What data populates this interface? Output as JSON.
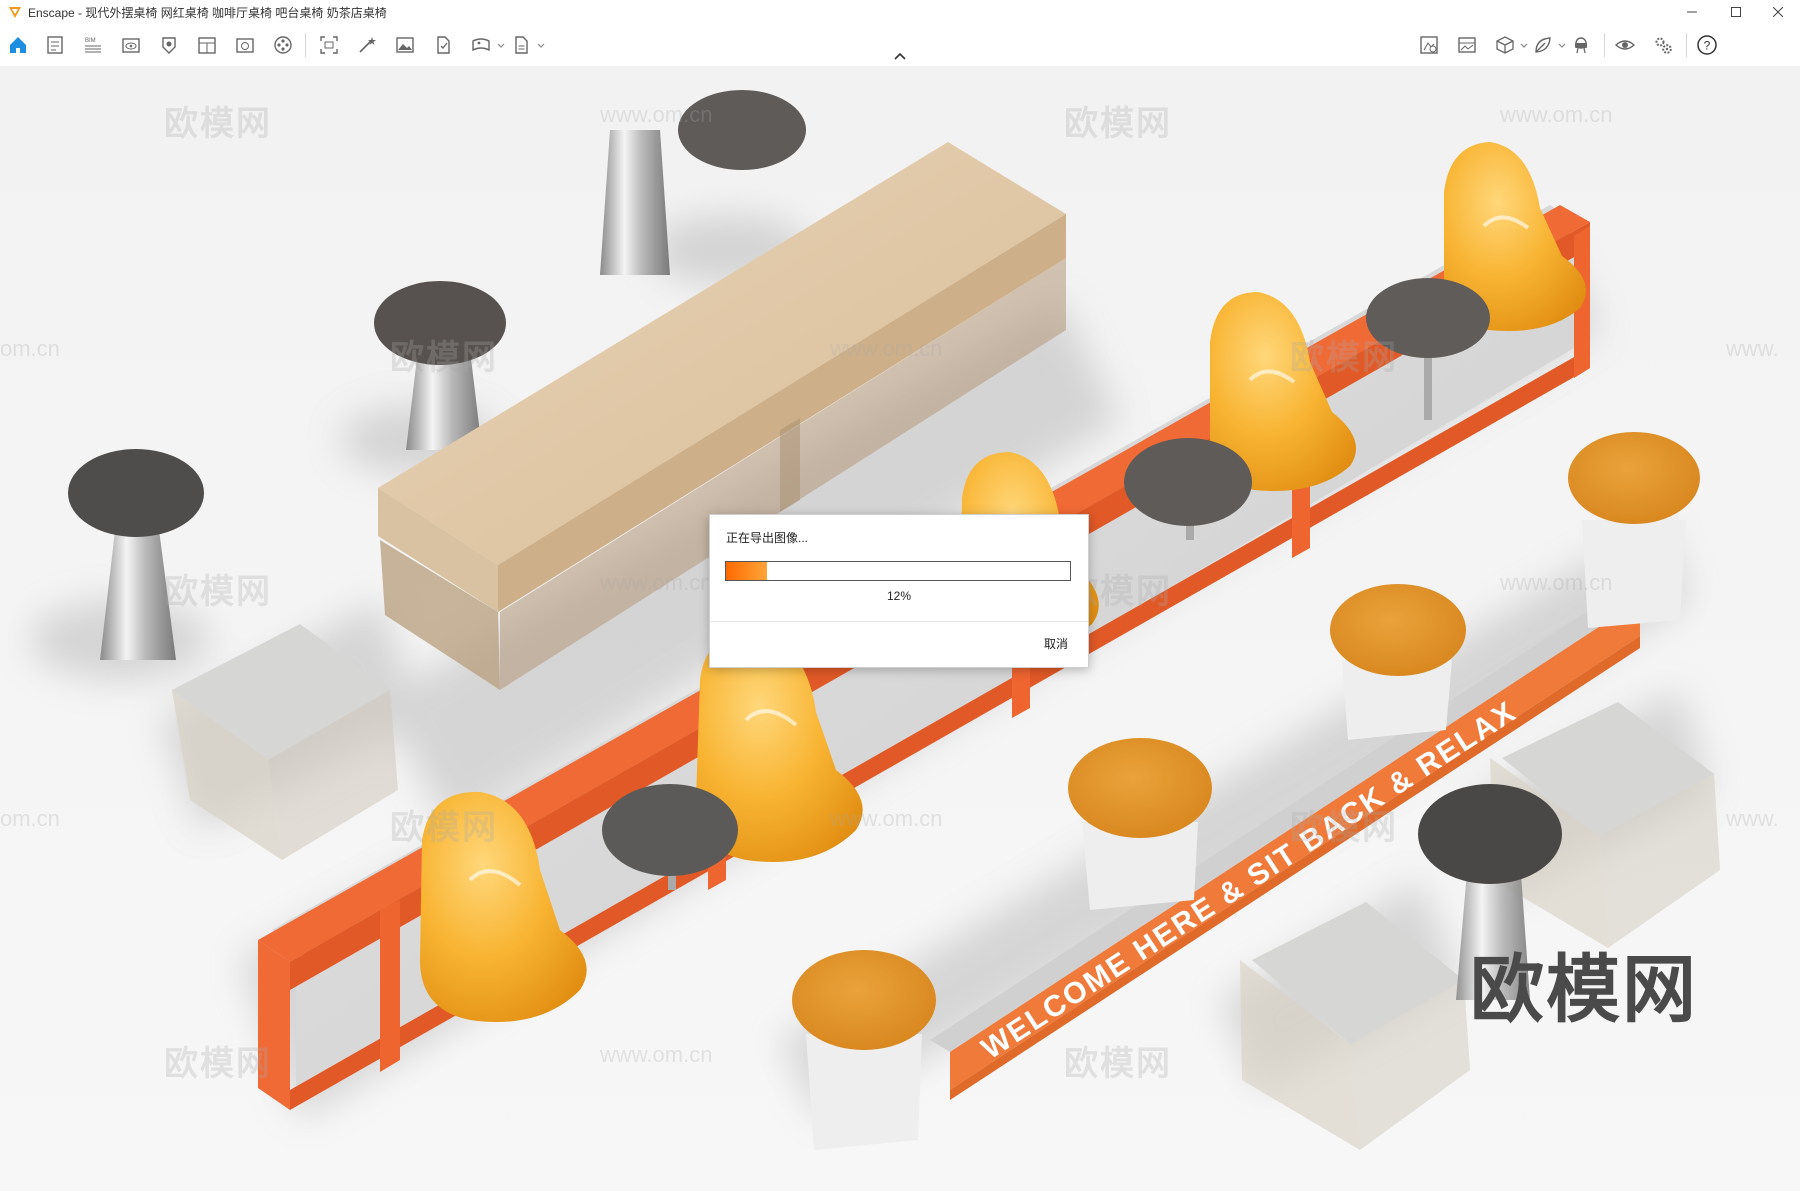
{
  "window": {
    "app_name": "Enscape",
    "title": "Enscape - 现代外摆桌椅 网红桌椅 咖啡厅桌椅 吧台桌椅 奶茶店桌椅",
    "controls": [
      "minimize-icon",
      "maximize-icon",
      "close-icon"
    ]
  },
  "toolbar": {
    "left_icons": [
      "home-icon",
      "render-settings-icon",
      "bim-icon",
      "view-icon",
      "asset-library-icon",
      "material-editor-icon",
      "capture-icon",
      "video-editor-icon",
      "screenshot-icon",
      "batch-render-icon",
      "image-icon",
      "export-icon",
      "panorama-icon",
      "exe-export-icon"
    ],
    "bim_label": "BIM",
    "right_icons": [
      "sync-views-icon",
      "image-compare-icon",
      "box-icon",
      "leaf-icon",
      "vr-headset-icon",
      "eye-icon",
      "settings-icon",
      "help-icon"
    ],
    "help_label": "?"
  },
  "watermarks": {
    "cn": "欧模网",
    "url": "www.om.cn",
    "url_partial": "om.cn",
    "url_prefix": "www.",
    "brand": "欧模网"
  },
  "scene": {
    "banner_text": "WELCOME HERE & SIT BACK & RELAX"
  },
  "export_dialog": {
    "title": "正在导出图像...",
    "progress": 0.12,
    "progress_text": "12%",
    "cancel_label": "取消",
    "accent_color": "#ff7a0d"
  }
}
